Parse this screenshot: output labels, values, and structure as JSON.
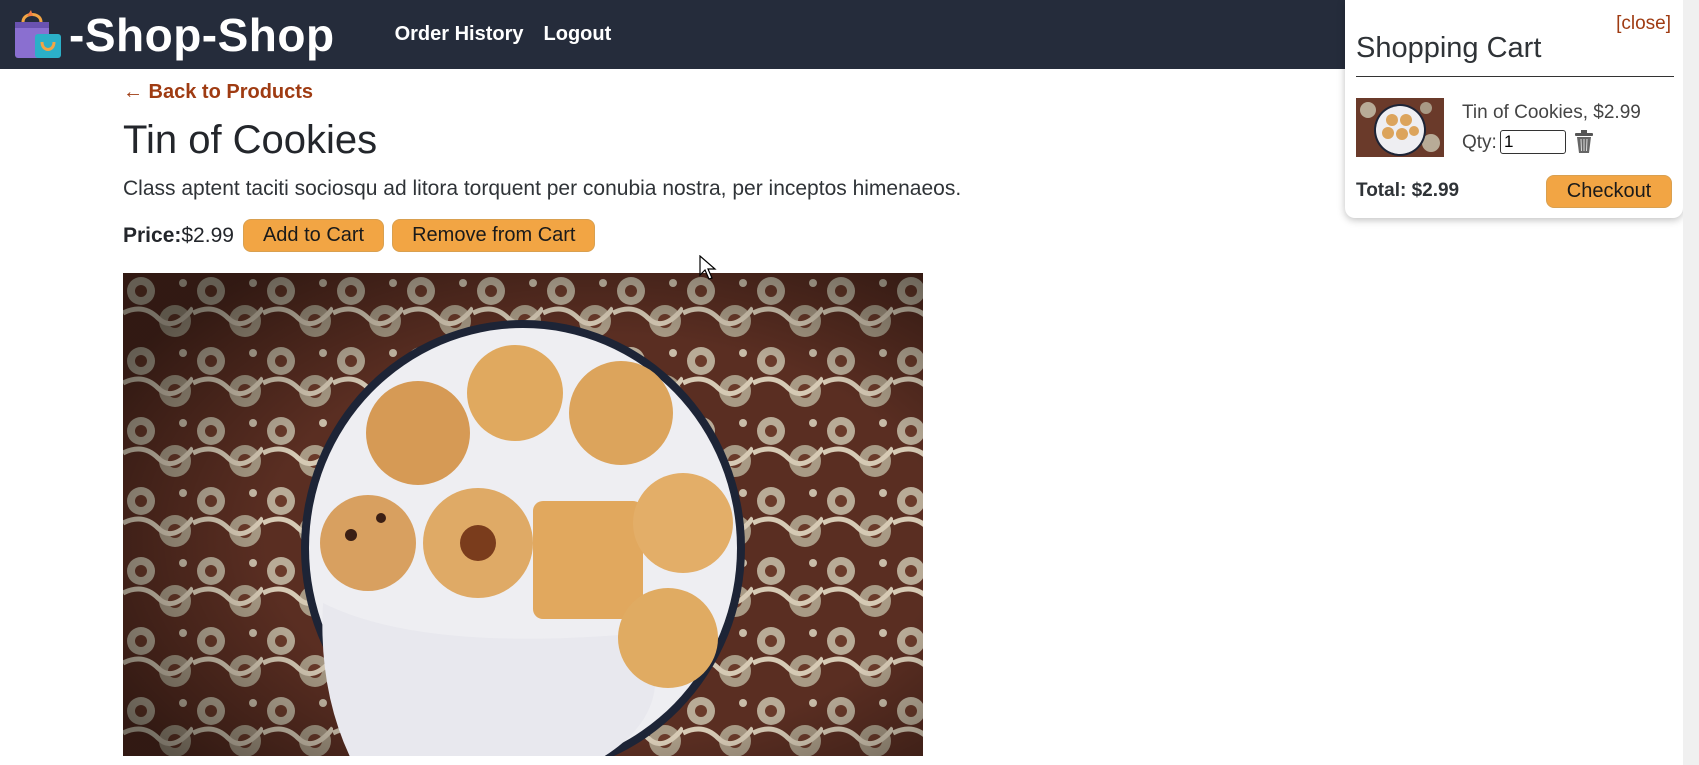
{
  "header": {
    "brand": "-Shop-Shop",
    "nav": [
      {
        "label": "Order History"
      },
      {
        "label": "Logout"
      }
    ]
  },
  "product": {
    "back_link": "← Back to Products",
    "name": "Tin of Cookies",
    "description": "Class aptent taciti sociosqu ad litora torquent per conubia nostra, per inceptos himenaeos.",
    "price_label": "Price:",
    "price": "$2.99",
    "add_button": "Add to Cart",
    "remove_button": "Remove from Cart"
  },
  "cart": {
    "close_label": "[close]",
    "title": "Shopping Cart",
    "items": [
      {
        "name": "Tin of Cookies, $2.99",
        "qty_label": "Qty:",
        "qty": "1"
      }
    ],
    "total": "Total: $2.99",
    "checkout_label": "Checkout"
  },
  "icons": {
    "logo": "shopping-bag-icon",
    "trash": "trash-icon",
    "cursor": "mouse-pointer-icon"
  },
  "colors": {
    "header_bg": "#252c3b",
    "accent_button": "#f2a544",
    "link": "#9f3b12"
  }
}
